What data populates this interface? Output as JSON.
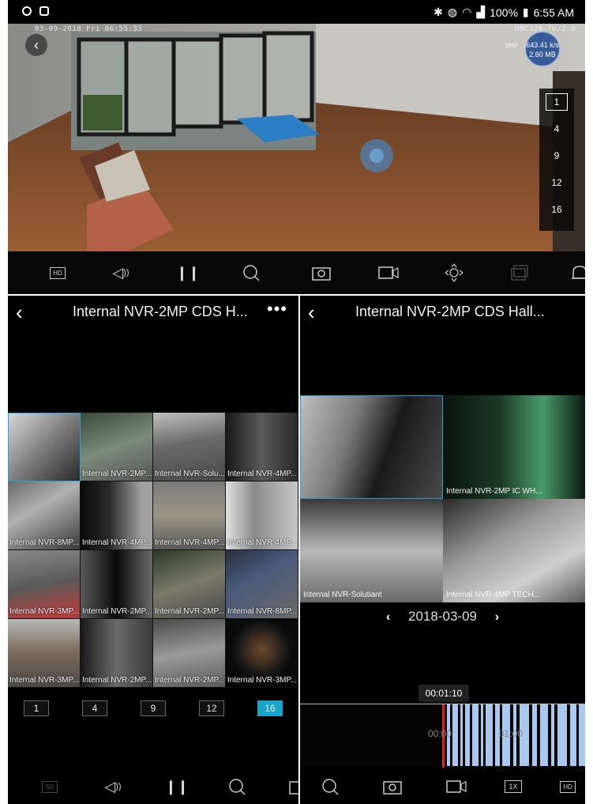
{
  "status_bar": {
    "battery": "100%",
    "time": "6:55 AM"
  },
  "main_view": {
    "osd_datetime": "03-09-2018 Fri 06:55:33",
    "osd_camera": "HNC328-TD/2.8",
    "osd_sub": "8MP L",
    "bitrate_rate": "643.41 k/s",
    "bitrate_total": "2.60 MB",
    "split_options": [
      "1",
      "4",
      "9",
      "12",
      "16"
    ],
    "split_selected": "1",
    "toolbar": {
      "hd": "HD"
    }
  },
  "multi_view": {
    "title": "Internal NVR-2MP CDS H...",
    "cells": [
      "",
      "Internal NVR-2MP...",
      "Internal NVR-Solu...",
      "Internal NVR-4MP...",
      "Internal NVR-8MP...",
      "Internal NVR-4MP...",
      "Internal NVR-4MP...",
      "Internal NVR-4MP...",
      "Internal NVR-3MP...",
      "Internal NVR-2MP...",
      "Internal NVR-2MP...",
      "Internal NVR-8MP...",
      "Internal NVR-3MP...",
      "Internal NVR-2MP...",
      "Internal NVR-2MP...",
      "Internal NVR-3MP..."
    ],
    "split_options": [
      "1",
      "4",
      "9",
      "12",
      "16"
    ],
    "split_selected": "16",
    "toolbar": {
      "sd": "SD"
    }
  },
  "playback": {
    "title": "Internal NVR-2MP CDS Hall...",
    "cells": [
      "",
      "Internal NVR-2MP IC WH...",
      "Internal NVR-Solutiant",
      "Internal NVR-4MP TECH..."
    ],
    "date": "2018-03-09",
    "current_time": "00:01:10",
    "tick_1": "00:00",
    "tick_2": "01:00",
    "speed": "1X",
    "hd": "HD"
  },
  "colors": {
    "accent": "#19a5c8",
    "timeline_bar": "#a8c8f0",
    "timeline_cursor": "#e02020"
  }
}
